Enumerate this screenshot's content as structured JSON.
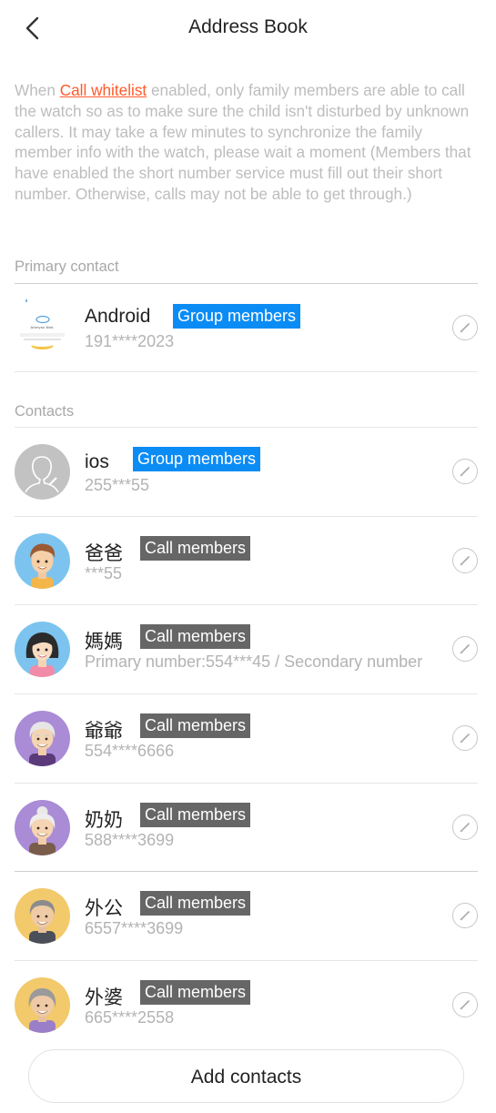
{
  "header": {
    "title": "Address Book",
    "back_icon": "chevron-left-icon"
  },
  "notice": {
    "prefix": "When ",
    "link": "Call whitelist",
    "body": " enabled, only family members are able to call the watch so as to make sure the child isn't disturbed by unknown callers. It may take a few minutes to synchronize the family member info with the watch, please wait a moment (Members that have enabled the short number service must fill out their short number. Otherwise, calls may not be able to get through.)"
  },
  "primary_section": {
    "label": "Primary contact"
  },
  "primary_contact": {
    "name": "Android",
    "badge": "Group members",
    "phone": "191****2023",
    "avatar_icon": "watch-device-icon"
  },
  "contacts_section": {
    "label": "Contacts"
  },
  "contacts": [
    {
      "name": "ios",
      "badge": "Group members",
      "phone": "255***55",
      "avatar_icon": "default-person-icon"
    },
    {
      "name": "爸爸",
      "badge": "Call members",
      "phone": "***55",
      "avatar_icon": "dad-avatar-icon"
    },
    {
      "name": "媽媽",
      "badge": "Call members",
      "phone": "Primary number:554***45 / Secondary number",
      "avatar_icon": "mom-avatar-icon"
    },
    {
      "name": "爺爺",
      "badge": "Call members",
      "phone": "554****6666",
      "avatar_icon": "grandpa-avatar-icon"
    },
    {
      "name": "奶奶",
      "badge": "Call members",
      "phone": "588****3699",
      "avatar_icon": "grandma-avatar-icon"
    },
    {
      "name": "外公",
      "badge": "Call members",
      "phone": "6557****3699",
      "avatar_icon": "maternal-grandpa-avatar-icon"
    },
    {
      "name": "外婆",
      "badge": "Call members",
      "phone": "665****2558",
      "avatar_icon": "maternal-grandma-avatar-icon"
    }
  ],
  "add_contacts": {
    "label": "Add contacts"
  },
  "colors": {
    "group_badge": "#0b8cf5",
    "call_badge": "#666666",
    "link": "#ff5a2b",
    "muted_text": "#bdbdbd"
  }
}
